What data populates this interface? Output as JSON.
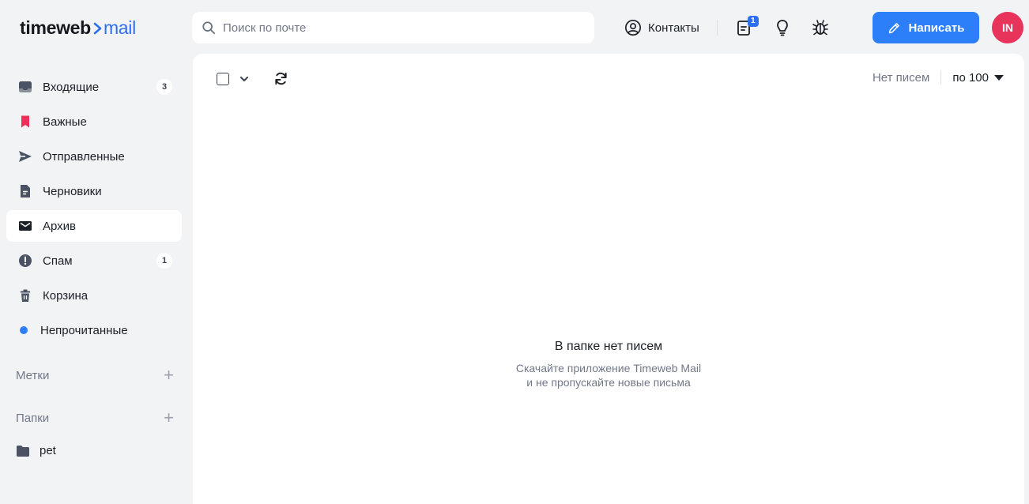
{
  "brand": {
    "part1": "timeweb",
    "part2": "mail"
  },
  "search": {
    "placeholder": "Поиск по почте"
  },
  "header": {
    "contacts_label": "Контакты",
    "tasks_badge": "1",
    "compose_label": "Написать",
    "avatar_initials": "IN"
  },
  "sidebar": {
    "items": [
      {
        "label": "Входящие",
        "count": "3",
        "icon": "inbox-icon"
      },
      {
        "label": "Важные",
        "icon": "bookmark-icon"
      },
      {
        "label": "Отправленные",
        "icon": "send-icon"
      },
      {
        "label": "Черновики",
        "icon": "draft-icon"
      },
      {
        "label": "Архив",
        "icon": "archive-icon",
        "active": true
      },
      {
        "label": "Спам",
        "count": "1",
        "icon": "spam-icon"
      },
      {
        "label": "Корзина",
        "icon": "trash-icon"
      },
      {
        "label": "Непрочитанные",
        "icon": "unread-dot"
      }
    ],
    "labels_title": "Метки",
    "folders_title": "Папки",
    "folders": [
      {
        "name": "pet"
      }
    ]
  },
  "list": {
    "status": "Нет писем",
    "per_page": "по 100"
  },
  "empty": {
    "title": "В папке нет писем",
    "line1": "Скачайте приложение Timeweb Mail",
    "line2": "и не пропускайте новые письма"
  },
  "colors": {
    "accent": "#2d7ff9",
    "avatar": "#e8345b",
    "important": "#ee2f57",
    "background": "#f2f3f5"
  }
}
